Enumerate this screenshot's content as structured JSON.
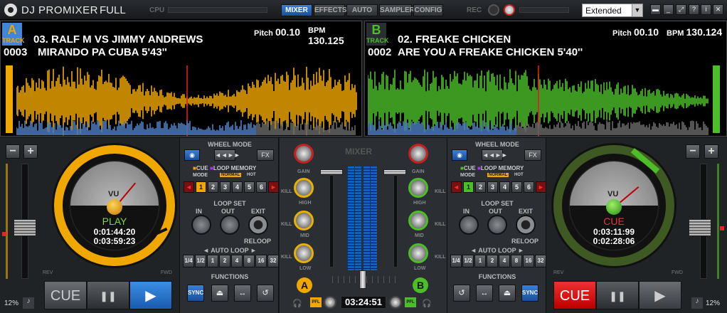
{
  "app": {
    "title": "DJ PROMIXER",
    "mode": "FULL",
    "cpu_label": "CPU",
    "rec_label": "REC"
  },
  "tabs": [
    {
      "label": "MIXER",
      "active": true
    },
    {
      "label": "EFFECTS",
      "active": false
    },
    {
      "label": "AUTO",
      "active": false
    },
    {
      "label": "SAMPLER",
      "active": false
    },
    {
      "label": "CONFIG",
      "active": false
    }
  ],
  "view_select": {
    "value": "Extended"
  },
  "window_buttons": [
    "▬",
    "_",
    "⤢",
    "?",
    "i",
    "✕"
  ],
  "deck_a": {
    "letter": "A",
    "track_label": "TRACK",
    "line1": "03. RALF M VS JIMMY ANDREWS",
    "line2_num": "0003",
    "line2_text": "MIRANDO PA CUBA 5'43''",
    "pitch_label": "Pitch",
    "pitch": "00.10",
    "bpm_label": "BPM",
    "bpm": "130.125",
    "state": "PLAY",
    "elapsed": "0:01:44:20",
    "remain": "0:03:59:23",
    "pitch_pct": "12%",
    "transport": {
      "cue": "CUE",
      "pause": "❚❚",
      "play": "▶"
    },
    "color": "#f0a800"
  },
  "deck_b": {
    "letter": "B",
    "track_label": "TRACK",
    "line1": "02. FREAKE CHICKEN",
    "line2_num": "0002",
    "line2_text": "ARE YOU A FREAKE CHICKEN 5'40''",
    "pitch_label": "Pitch",
    "pitch": "00.10",
    "bpm_label": "BPM",
    "bpm": "130.124",
    "state": "CUE",
    "elapsed": "0:03:11:99",
    "remain": "0:02:28:06",
    "pitch_pct": "12%",
    "transport": {
      "cue": "CUE",
      "pause": "❚❚",
      "play": "▶"
    },
    "color": "#4cbf28"
  },
  "panel": {
    "wheel_mode": "WHEEL MODE",
    "fx": "FX",
    "cue": "CUE",
    "loop": "LOOP",
    "memory": "MEMORY",
    "mode": "MODE",
    "normal": "NORMAL",
    "hot": "HOT",
    "hot_cues": [
      "1",
      "2",
      "3",
      "4",
      "5",
      "6"
    ],
    "loop_set": "LOOP SET",
    "in": "IN",
    "out": "OUT",
    "exit": "EXIT",
    "reloop": "RELOOP",
    "auto_loop": "◄ AUTO  LOOP ►",
    "loop_lengths": [
      "1/4",
      "1/2",
      "1",
      "2",
      "4",
      "8",
      "16",
      "32"
    ],
    "functions": "FUNCTIONS",
    "sync": "SYNC"
  },
  "mixer": {
    "title": "MIXER",
    "gain": "GAIN",
    "high": "HIGH",
    "mid": "MID",
    "low": "LOW",
    "kill": "KILL",
    "deck_a": "A",
    "deck_b": "B",
    "pfl": "PFL",
    "time": "03:24:51"
  },
  "vu_label": "VU",
  "jog_labels": {
    "rev": "REV",
    "fwd": "FWD"
  }
}
